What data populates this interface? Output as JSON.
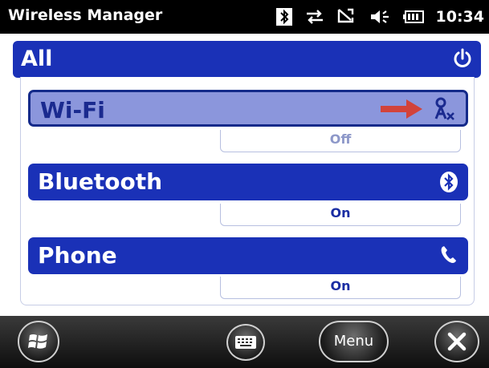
{
  "app": {
    "title": "Wireless Manager"
  },
  "status": {
    "clock": "10:34"
  },
  "all": {
    "label": "All"
  },
  "radios": [
    {
      "label": "Wi-Fi",
      "state": "Off"
    },
    {
      "label": "Bluetooth",
      "state": "On"
    },
    {
      "label": "Phone",
      "state": "On"
    }
  ],
  "softkeys": {
    "menu": "Menu"
  },
  "colors": {
    "accent": "#1a31b7",
    "wifi_highlight": "#8b96dc",
    "arrow": "#d2433b"
  },
  "icons": {
    "tray": [
      "bluetooth-icon",
      "data-connection-icon",
      "signal-icon",
      "volume-icon",
      "battery-icon"
    ],
    "all": "power-icon",
    "wifi": "wifi-off-icon",
    "bluetooth": "bluetooth-icon",
    "phone": "phone-icon"
  }
}
